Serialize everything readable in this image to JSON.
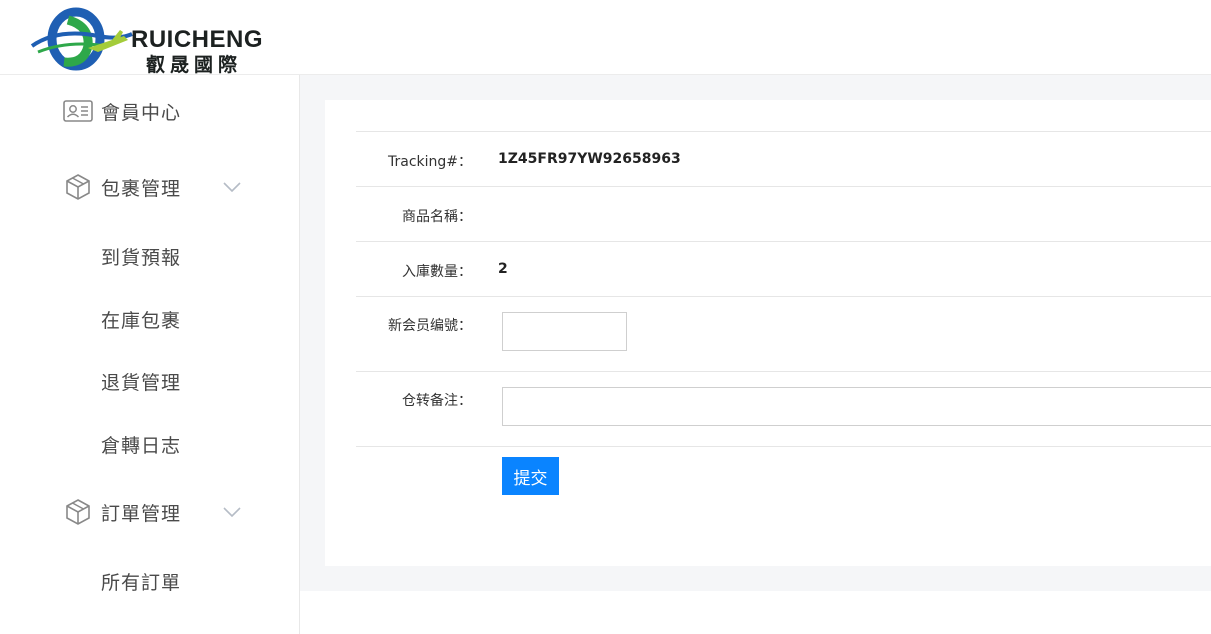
{
  "brand": {
    "name_en": "RUICHENG",
    "name_cn": "叡晟國際",
    "colors": {
      "blue": "#1f5fb3",
      "green": "#2ea84a",
      "lime": "#a4cc3a"
    }
  },
  "sidebar": {
    "items": [
      {
        "label": "會員中心",
        "icon": "id-card-icon"
      },
      {
        "label": "包裹管理",
        "icon": "package-icon",
        "expanded": true,
        "children": [
          "到貨預報",
          "在庫包裹",
          "退貨管理",
          "倉轉日志"
        ]
      },
      {
        "label": "訂單管理",
        "icon": "package-icon",
        "expanded": true,
        "children": [
          "所有訂單"
        ]
      }
    ]
  },
  "form": {
    "tracking_label": "Tracking#：",
    "tracking_value": "1Z45FR97YW92658963",
    "product_label": "商品名稱：",
    "product_value": "",
    "qty_label": "入庫數量：",
    "qty_value": "2",
    "member_label": "新会员编號：",
    "member_value": "",
    "note_label": "仓转备注：",
    "note_value": "",
    "submit_label": "提交"
  },
  "colors": {
    "accent": "#0a84ff",
    "content_bg": "#f5f6f8"
  }
}
